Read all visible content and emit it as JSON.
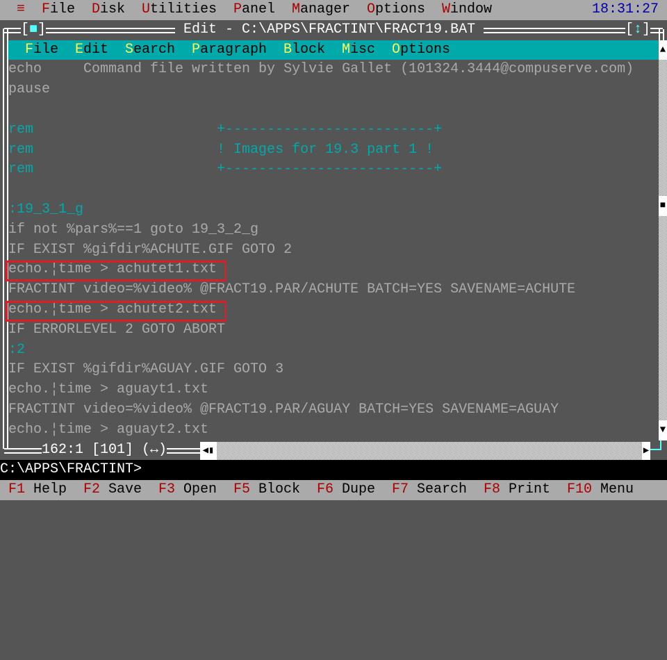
{
  "top_menu": {
    "system_icon": "≡",
    "items": [
      {
        "hotkey": "F",
        "rest": "ile"
      },
      {
        "hotkey": "D",
        "rest": "isk"
      },
      {
        "hotkey": "U",
        "rest": "tilities"
      },
      {
        "hotkey": "P",
        "rest": "anel"
      },
      {
        "hotkey": "M",
        "rest": "anager"
      },
      {
        "hotkey": "O",
        "rest": "ptions"
      },
      {
        "hotkey": "W",
        "rest": "indow"
      }
    ],
    "clock": "18:31:27"
  },
  "editor": {
    "title": " Edit - C:\\APPS\\FRACTINT\\FRACT19.BAT ",
    "close_button": "[■]",
    "resize_button": "[↕]",
    "menu": [
      {
        "hotkey": "F",
        "rest": "ile"
      },
      {
        "hotkey": "E",
        "rest": "dit"
      },
      {
        "hotkey": "S",
        "rest": "earch"
      },
      {
        "hotkey": "P",
        "rest": "aragraph"
      },
      {
        "hotkey": "B",
        "rest": "lock"
      },
      {
        "hotkey": "M",
        "rest": "isc"
      },
      {
        "hotkey": "O",
        "rest": "ptions"
      }
    ],
    "lines": [
      {
        "text": "echo     Command file written by Sylvie Gallet (101324.3444@compuserve.com)",
        "color": "gray"
      },
      {
        "text": "pause",
        "color": "gray"
      },
      {
        "text": "",
        "color": "gray"
      },
      {
        "text": "rem                      +-------------------------+",
        "color": "cyan"
      },
      {
        "text": "rem                      ! Images for 19.3 part 1 !",
        "color": "cyan"
      },
      {
        "text": "rem                      +-------------------------+",
        "color": "cyan"
      },
      {
        "text": "",
        "color": "gray"
      },
      {
        "text": ":19_3_1_g",
        "color": "cyan"
      },
      {
        "text": "if not %pars%==1 goto 19_3_2_g",
        "color": "gray"
      },
      {
        "text": "IF EXIST %gifdir%ACHUTE.GIF GOTO 2",
        "color": "gray"
      },
      {
        "text": "echo.¦time > achutet1.txt",
        "color": "gray",
        "highlighted": true
      },
      {
        "text": "FRACTINT video=%video% @FRACT19.PAR/ACHUTE BATCH=YES SAVENAME=ACHUTE",
        "color": "gray"
      },
      {
        "text": "echo.¦time > achutet2.txt",
        "color": "gray",
        "highlighted": true
      },
      {
        "text": "IF ERRORLEVEL 2 GOTO ABORT",
        "color": "gray"
      },
      {
        "text": ":2",
        "color": "cyan"
      },
      {
        "text": "IF EXIST %gifdir%AGUAY.GIF GOTO 3",
        "color": "gray"
      },
      {
        "text": "echo.¦time > aguayt1.txt",
        "color": "gray"
      },
      {
        "text": "FRACTINT video=%video% @FRACT19.PAR/AGUAY BATCH=YES SAVENAME=AGUAY",
        "color": "gray"
      },
      {
        "text": "echo.¦time > aguayt2.txt",
        "color": "gray"
      }
    ],
    "status": "162:1 [101] (↔)",
    "vertical_scroll_fraction": 0.4,
    "colors": {
      "background": "#555555",
      "text": "#aaaaaa",
      "cyan": "#00aaaa",
      "menu_bar": "#00aaaa",
      "hotkey": "#ffff55",
      "highlight_box": "#e01c24"
    }
  },
  "prompt": "C:\\APPS\\FRACTINT>",
  "function_keys": [
    {
      "key": "F1",
      "label": "Help"
    },
    {
      "key": "F2",
      "label": "Save"
    },
    {
      "key": "F3",
      "label": "Open"
    },
    {
      "key": "F5",
      "label": "Block"
    },
    {
      "key": "F6",
      "label": "Dupe"
    },
    {
      "key": "F7",
      "label": "Search"
    },
    {
      "key": "F8",
      "label": "Print"
    },
    {
      "key": "F10",
      "label": "Menu"
    }
  ]
}
